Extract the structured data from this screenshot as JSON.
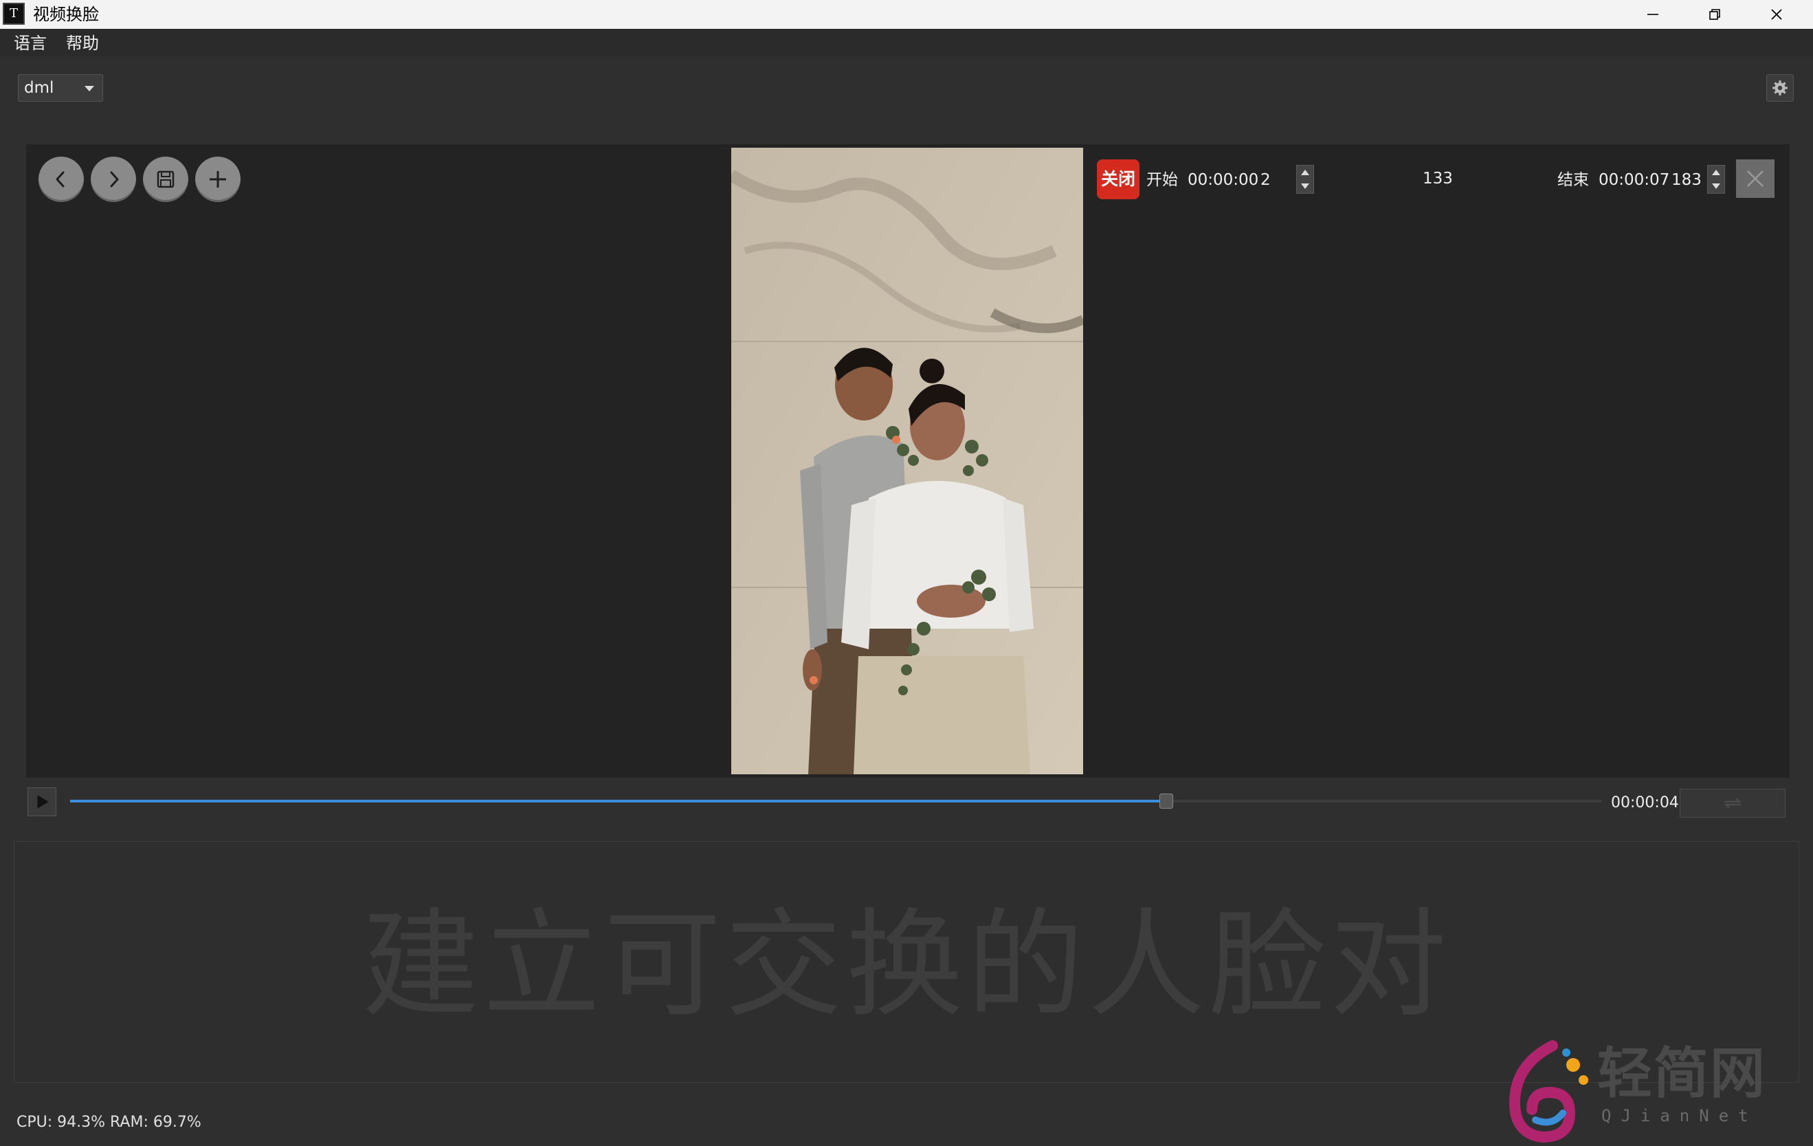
{
  "window": {
    "title": "视频换脸",
    "icon_letter": "T"
  },
  "menu": {
    "items": [
      "语言",
      "帮助"
    ]
  },
  "device": {
    "selected": "dml"
  },
  "controls": {
    "toggle_label": "关闭",
    "start_label": "开始",
    "start_time": "00:00:00",
    "start_frame": "2",
    "total_frames": "133",
    "end_label": "结束",
    "end_time": "00:00:07",
    "end_frame": "183"
  },
  "timeline": {
    "current_time": "00:00:04",
    "progress": 0.716
  },
  "faces": {
    "hint": "建立可交换的人脸对"
  },
  "status": {
    "text": "CPU: 94.3%  RAM: 69.7%"
  },
  "watermark": {
    "title": "轻简网",
    "subtitle": "QJianNet"
  },
  "colors": {
    "accent": "#3b8de0",
    "toggle": "#d52b1e",
    "panel": "#232323",
    "background": "#2f2f2f"
  },
  "icons": [
    "back-icon",
    "forward-icon",
    "save-icon",
    "add-icon",
    "gear-icon",
    "play-icon",
    "close-icon",
    "loop-icon",
    "minimize-icon",
    "restore-icon"
  ]
}
